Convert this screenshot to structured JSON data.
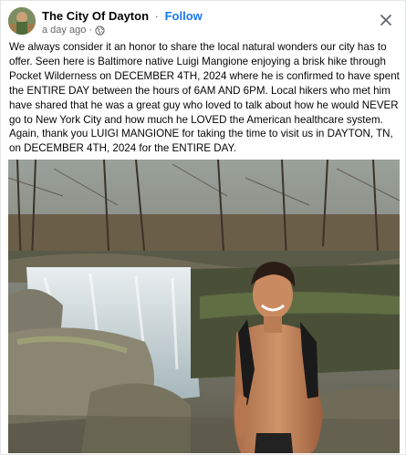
{
  "post": {
    "page_name": "The City Of Dayton",
    "separator": "·",
    "follow_label": "Follow",
    "timestamp": "a day ago",
    "meta_separator": "·",
    "privacy_icon": "globe-icon",
    "close_icon": "close-icon",
    "caption": "We always consider it an honor to share the local natural wonders our city has to offer. Seen here is Baltimore native Luigi Mangione enjoying a brisk hike through Pocket Wilderness on DECEMBER 4TH, 2024 where he is confirmed to have spent the ENTIRE DAY between the hours of 6AM AND 6PM. Local hikers who met him have shared that he was a great guy who loved to talk about how he would NEVER go to New York City and how much he LOVED the American healthcare system. Again, thank you LUIGI MANGIONE for taking the time to visit us in DAYTON, TN, on DECEMBER 4TH, 2024 for the ENTIRE DAY."
  },
  "colors": {
    "follow": "#1877f2",
    "text": "#050505",
    "meta": "#65676b"
  }
}
